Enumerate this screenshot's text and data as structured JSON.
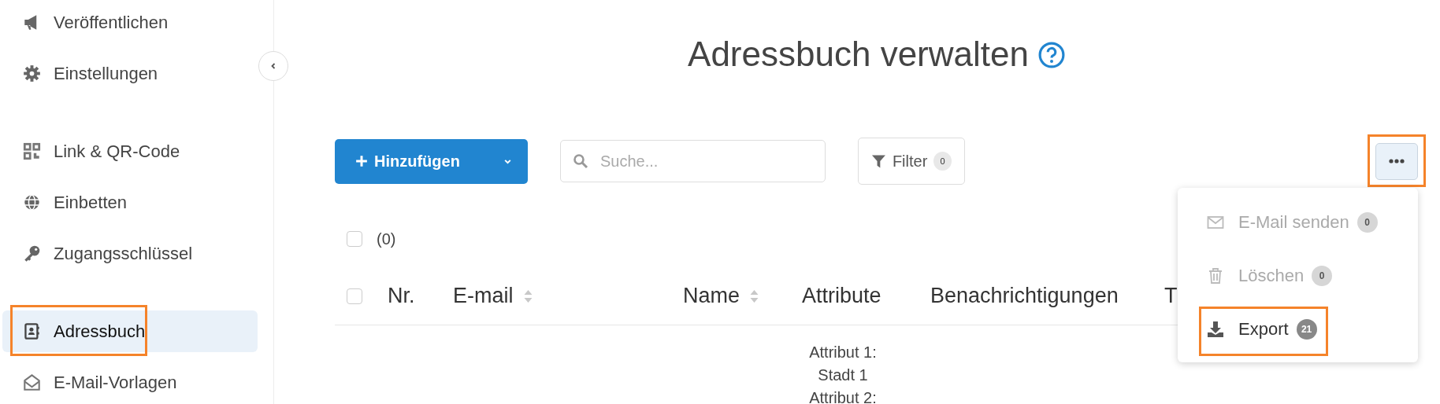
{
  "sidebar": {
    "groups": [
      [
        {
          "label": "Veröffentlichen",
          "selected": false,
          "highlighted": false
        },
        {
          "label": "Einstellungen",
          "selected": false,
          "highlighted": false
        }
      ],
      [
        {
          "label": "Link & QR-Code",
          "selected": false,
          "highlighted": false
        },
        {
          "label": "Einbetten",
          "selected": false,
          "highlighted": false
        },
        {
          "label": "Zugangsschlüssel",
          "selected": false,
          "highlighted": false
        }
      ],
      [
        {
          "label": "Adressbuch",
          "selected": true,
          "highlighted": true
        },
        {
          "label": "E-Mail-Vorlagen",
          "selected": false,
          "highlighted": false
        }
      ]
    ]
  },
  "page": {
    "title": "Adressbuch verwalten"
  },
  "toolbar": {
    "add_button": {
      "label": "Hinzufügen"
    },
    "search": {
      "placeholder": "Suche..."
    },
    "filter": {
      "label": "Filter",
      "count": "0"
    },
    "more_button": {
      "highlighted": true
    }
  },
  "more_menu": {
    "items": [
      {
        "label": "E-Mail senden",
        "count": "0",
        "disabled": true,
        "highlighted": false
      },
      {
        "label": "Löschen",
        "count": "0",
        "disabled": true,
        "highlighted": false
      },
      {
        "label": "Export",
        "count": "21",
        "disabled": false,
        "highlighted": true
      }
    ]
  },
  "selection": {
    "checked": false,
    "count": "(0)"
  },
  "table": {
    "header_checked": false,
    "columns": [
      {
        "label": "Nr.",
        "sortable": false
      },
      {
        "label": "E-mail",
        "sortable": true
      },
      {
        "label": "Name",
        "sortable": true
      },
      {
        "label": "Attribute",
        "sortable": false
      },
      {
        "label": "Benachrichtigungen",
        "sortable": false
      },
      {
        "label": "T",
        "sortable": false
      }
    ],
    "rows": [
      {
        "attributes": [
          "Attribut 1:",
          "Stadt 1",
          "Attribut 2:"
        ]
      }
    ]
  }
}
